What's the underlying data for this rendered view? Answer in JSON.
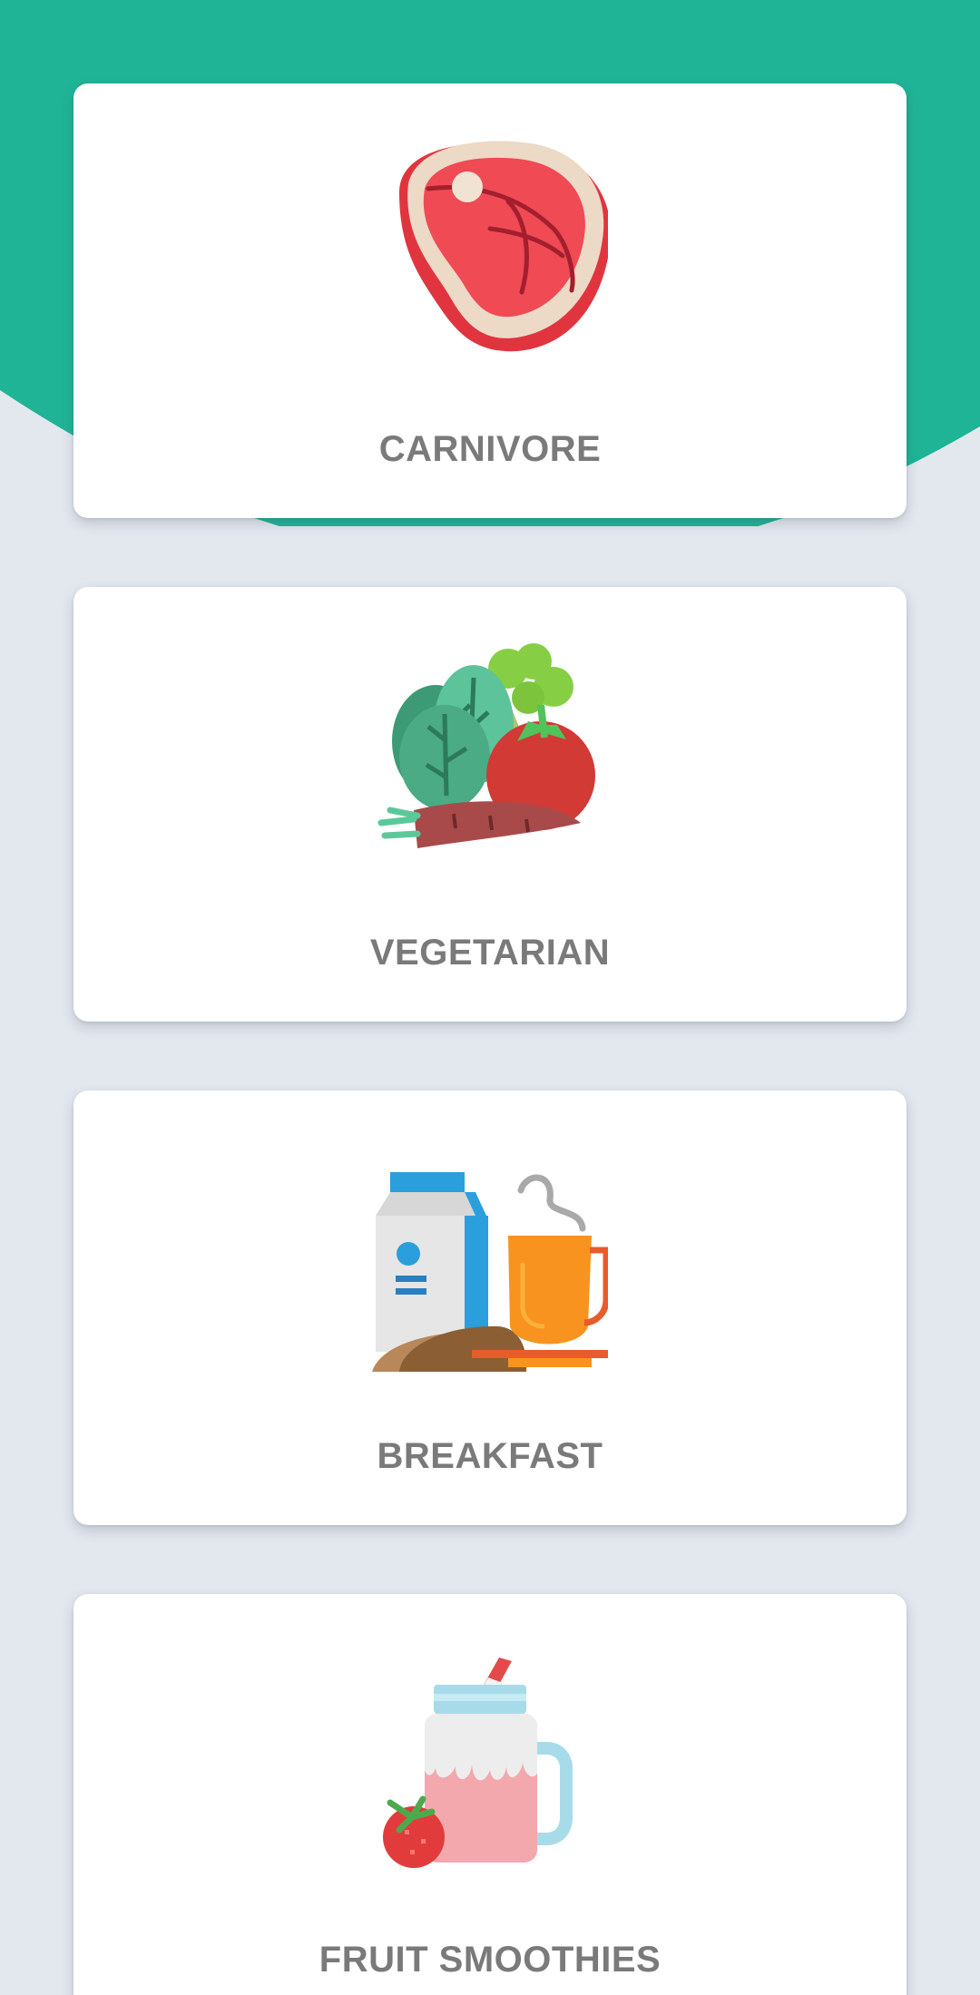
{
  "theme": {
    "header_color": "#20b496",
    "background_color": "#e3e8ef",
    "card_color": "#ffffff",
    "label_color": "#7a7a7a"
  },
  "categories": [
    {
      "label": "CARNIVORE",
      "icon": "steak-icon"
    },
    {
      "label": "VEGETARIAN",
      "icon": "vegetables-icon"
    },
    {
      "label": "BREAKFAST",
      "icon": "breakfast-icon"
    },
    {
      "label": "FRUIT SMOOTHIES",
      "icon": "smoothie-icon"
    }
  ]
}
